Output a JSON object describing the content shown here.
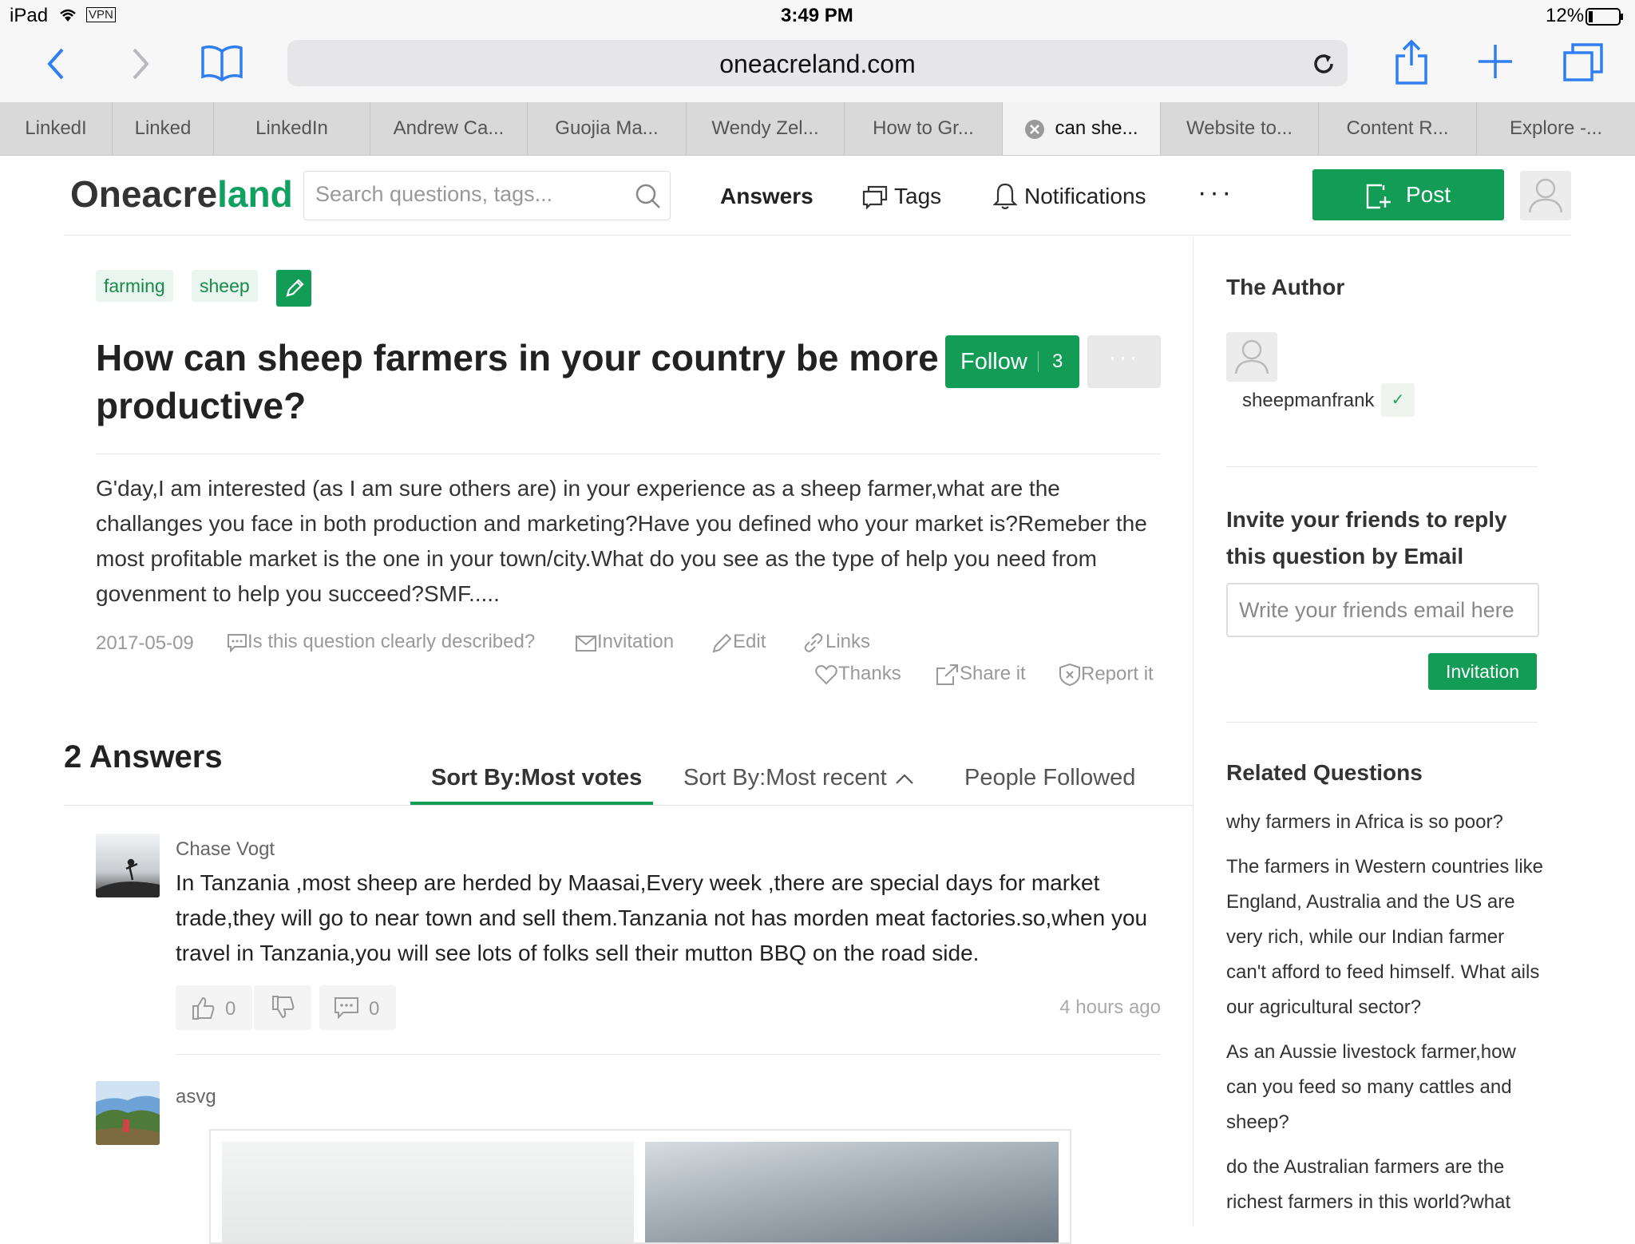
{
  "status_bar": {
    "device": "iPad",
    "vpn": "VPN",
    "time": "3:49 PM",
    "battery": "12%"
  },
  "browser": {
    "url": "oneacreland.com",
    "tabs": [
      "LinkedI",
      "Linked",
      "LinkedIn",
      "Andrew Ca...",
      "Guojia Ma...",
      "Wendy Zel...",
      "How to Gr...",
      "can she...",
      "Website to...",
      "Content R...",
      "Explore -..."
    ],
    "active_tab": 7
  },
  "site": {
    "logo_dark": "Oneacre",
    "logo_green": "land",
    "search_placeholder": "Search questions, tags...",
    "nav": {
      "answers": "Answers",
      "tags": "Tags",
      "notifications": "Notifications",
      "more": "···"
    },
    "post_label": "Post"
  },
  "question": {
    "tags": [
      "farming",
      "sheep"
    ],
    "title": "How can sheep farmers in your country be more productive?",
    "follow_label": "Follow",
    "follow_count": "3",
    "more_label": "···",
    "body": "G'day,I am interested (as I am sure others are) in your experience as a sheep farmer,what are the challanges you face in both production and marketing?Have you defined who your market is?Remeber the most profitable market is the one in your town/city.What do you see as the type of help you need from govenment to help you succeed?SMF.....",
    "date": "2017-05-09",
    "actions": {
      "clarity": "Is this question clearly described?",
      "invitation": "Invitation",
      "edit": "Edit",
      "links": "Links",
      "thanks": "Thanks",
      "share": "Share it",
      "report": "Report it"
    }
  },
  "answers": {
    "heading": "2 Answers",
    "sort_votes": "Sort By:Most votes",
    "sort_recent": "Sort By:Most recent",
    "people_followed": "People Followed",
    "items": [
      {
        "author": "Chase Vogt",
        "body": "In Tanzania ,most sheep are herded by Maasai,Every week ,there are special days for market trade,they will go to near town and sell them.Tanzania not has morden meat factories.so,when you travel in Tanzania,you will see lots of folks sell their mutton BBQ on the road side.",
        "upvotes": "0",
        "comments": "0",
        "time": "4 hours ago"
      },
      {
        "author": "asvg"
      }
    ]
  },
  "sidebar": {
    "author_heading": "The Author",
    "author_name": "sheepmanfrank",
    "verified_mark": "✓",
    "invite_heading": "Invite your friends to reply this question by Email",
    "email_placeholder": "Write your friends email here",
    "invite_button": "Invitation",
    "related_heading": "Related Questions",
    "related": [
      "why farmers in Africa is so poor?",
      "The farmers in Western countries like England, Australia and the US are very rich, while our Indian farmer can't afford to feed himself. What ails our agricultural sector?",
      "As an Aussie livestock farmer,how can you feed so many cattles and sheep?",
      "do the Australian farmers are the richest farmers in this world?what"
    ]
  },
  "colors": {
    "brand_green": "#129c55",
    "ios_blue": "#2f7ff0"
  }
}
